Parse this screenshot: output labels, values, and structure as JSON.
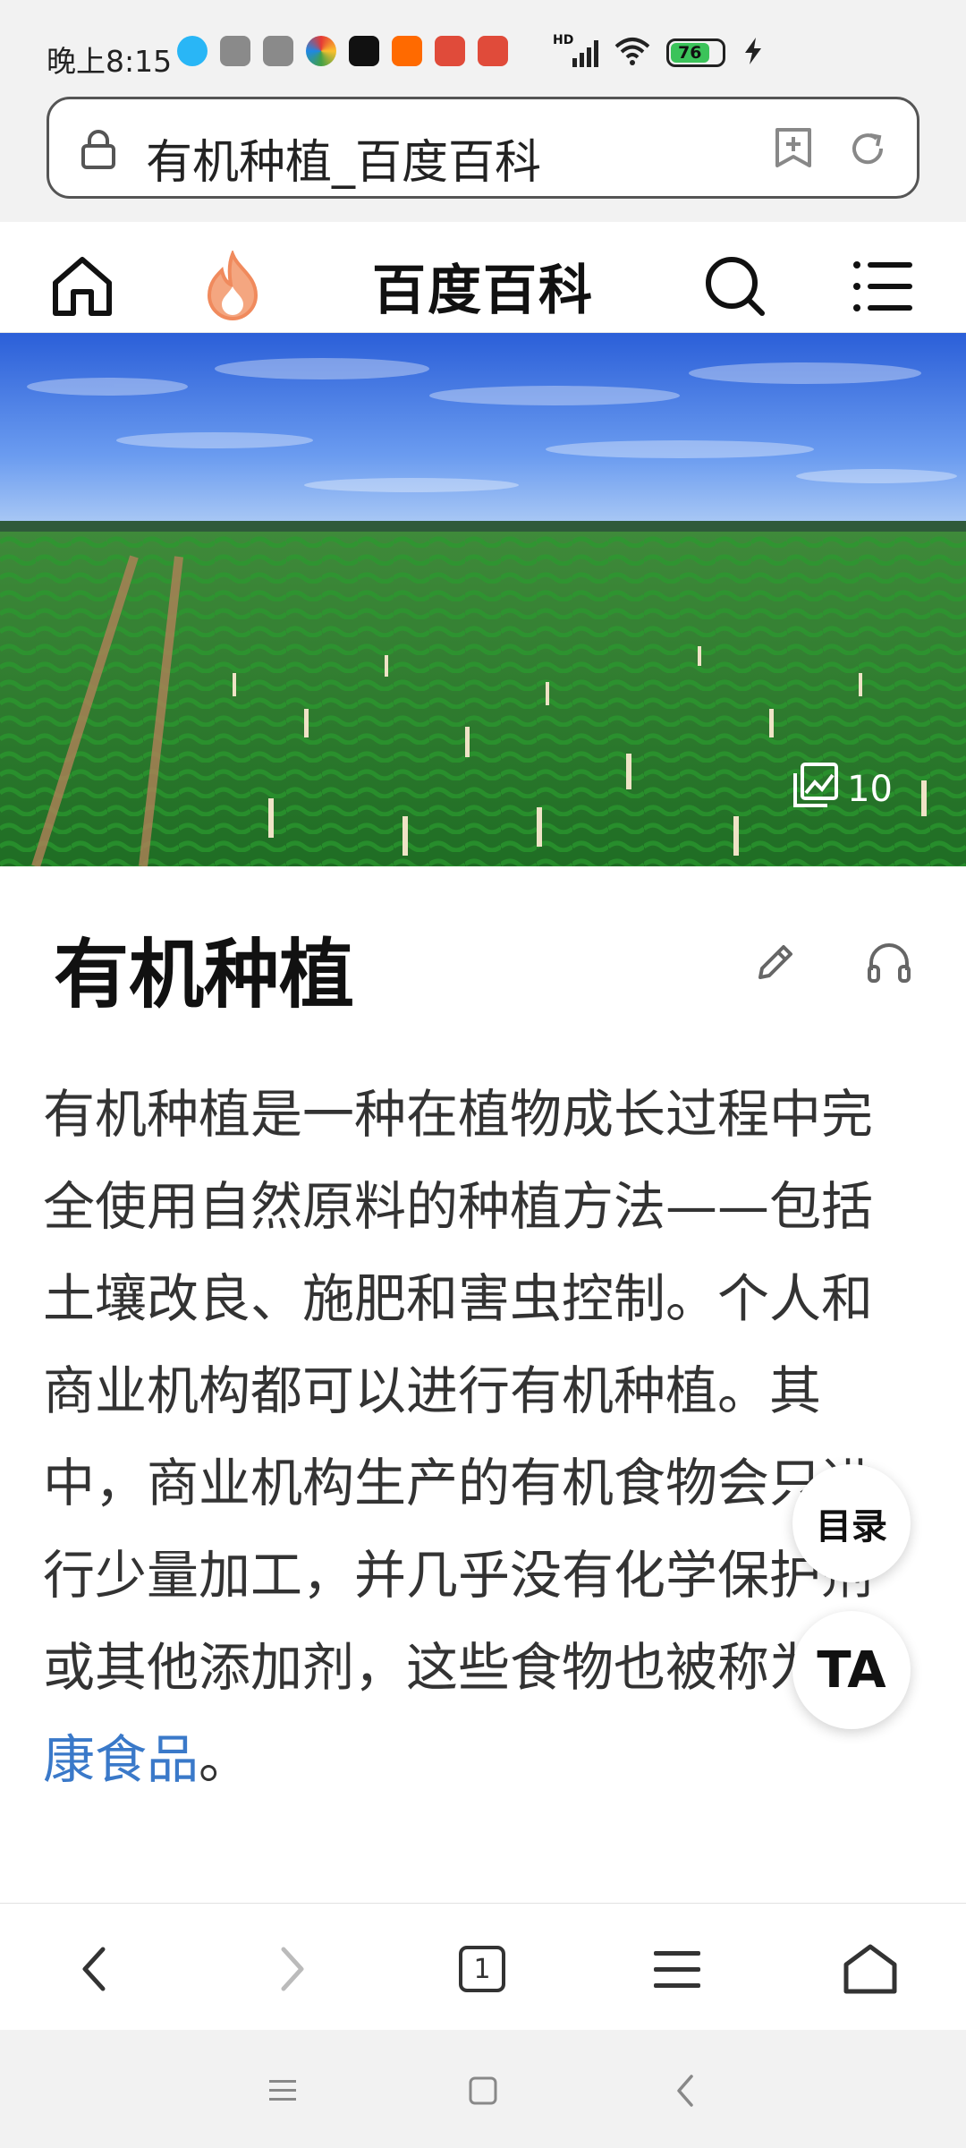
{
  "status_bar": {
    "time": "晚上8:15",
    "network": "HD",
    "battery_level": "76",
    "notification_icons": [
      "qq-icon",
      "app-icon",
      "app-icon",
      "weibo-icon",
      "douyin-icon",
      "taobao-icon",
      "app-icon",
      "app-icon"
    ]
  },
  "url_bar": {
    "title": "有机种植_百度百科"
  },
  "site_nav": {
    "title": "百度百科"
  },
  "hero": {
    "photo_count": "10"
  },
  "article": {
    "title": "有机种植",
    "body": "有机种植是一种在植物成长过程中完全使用自然原料的种植方法——包括土壤改良、施肥和害虫控制。个人和商业机构都可以进行有机种植。其中，商业机构生产的有机食物会只进行少量加工，并几乎没有化学保护剂或其他添加剂，这些食物也被称为",
    "link_text": "健康食品",
    "tail": "。"
  },
  "floating": {
    "toc_label": "目录",
    "ta_label": "TA"
  },
  "toolbar": {
    "tab_count": "1"
  },
  "colors": {
    "link": "#3a79c9",
    "flame": "#f08a5d"
  }
}
